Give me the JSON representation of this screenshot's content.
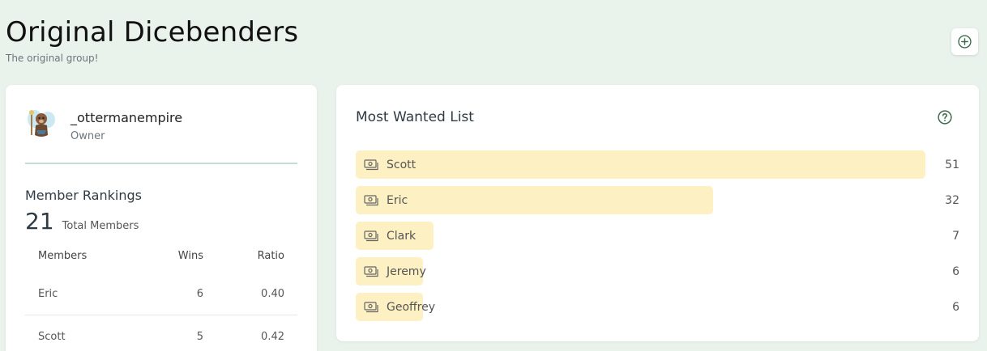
{
  "header": {
    "title": "Original Dicebenders",
    "subtitle": "The original group!"
  },
  "owner": {
    "name": "_ottermanempire",
    "role": "Owner"
  },
  "rankings": {
    "title": "Member Rankings",
    "total": "21",
    "total_label": "Total Members",
    "columns": [
      "Members",
      "Wins",
      "Ratio"
    ],
    "rows": [
      {
        "name": "Eric",
        "wins": "6",
        "ratio": "0.40"
      },
      {
        "name": "Scott",
        "wins": "5",
        "ratio": "0.42"
      }
    ]
  },
  "most_wanted": {
    "title": "Most Wanted List",
    "max_value": 51,
    "items": [
      {
        "name": "Scott",
        "value": 51
      },
      {
        "name": "Eric",
        "value": 32
      },
      {
        "name": "Clark",
        "value": 7
      },
      {
        "name": "Jeremy",
        "value": 6
      },
      {
        "name": "Geoffrey",
        "value": 6
      }
    ]
  },
  "colors": {
    "background": "#e9f2eb",
    "bar": "#fdf0c2",
    "accent": "#3b6b4a"
  },
  "icons": {
    "add": "plus-circle-icon",
    "help": "question-circle-icon",
    "bounty": "money-bill-icon"
  }
}
